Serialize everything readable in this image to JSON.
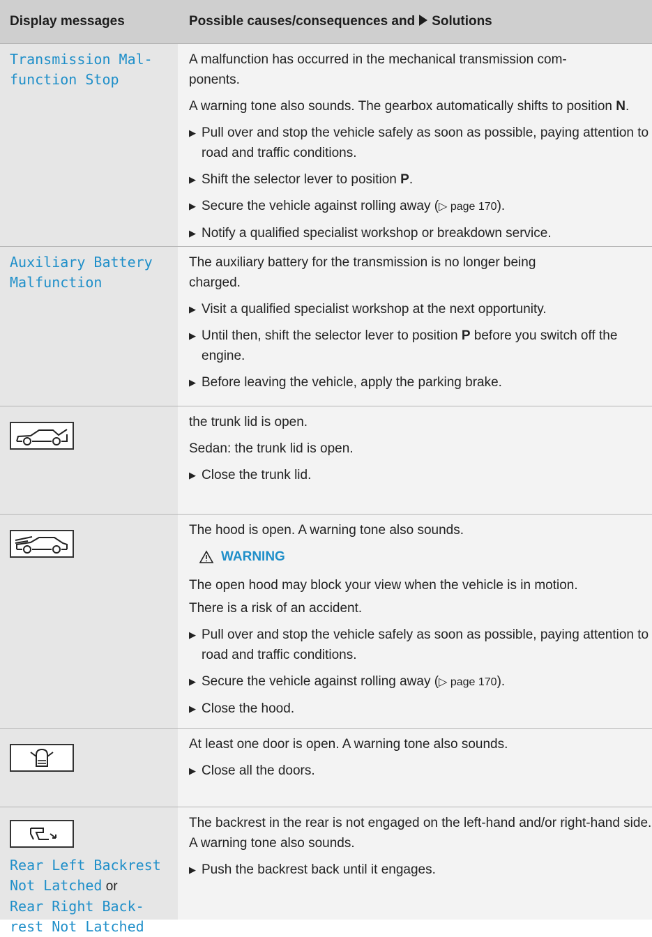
{
  "header": {
    "col1": "Display messages",
    "col2_a": "Possible causes/consequences and",
    "col2_b": "Solutions"
  },
  "rows": {
    "r0": {
      "msg": "Transmission Mal-\nfunction Stop",
      "p1": "A malfunction has occurred in the mechanical transmission com-\nponents.",
      "p2a": "A warning tone also sounds. The gearbox automatically shifts to position ",
      "p2b": "N",
      "p2c": ".",
      "b1": "Pull over and stop the vehicle safely as soon as possible, paying attention to road and traffic conditions.",
      "b2a": "Shift the selector lever to position ",
      "b2b": "P",
      "b2c": ".",
      "b3a": "Secure the vehicle against rolling away (",
      "b3ref": "▷ page 170",
      "b3c": ").",
      "b4": "Notify a qualified specialist workshop or breakdown service."
    },
    "r1": {
      "msg": "Auxiliary Battery\nMalfunction",
      "p1": "The auxiliary battery for the transmission is no longer being charged.",
      "b1": "Visit a qualified specialist workshop at the next opportunity.",
      "b2a": "Until then, shift the selector lever to position ",
      "b2b": "P",
      "b2c": " before you switch off the engine.",
      "b3": "Before leaving the vehicle, apply the parking brake."
    },
    "r2": {
      "icon": "trunk-open-icon",
      "p1": "the trunk lid is open.",
      "p2": "Sedan: the trunk lid is open.",
      "b1": "Close the trunk lid."
    },
    "r3": {
      "icon": "hood-open-icon",
      "p1": "The hood is open. A warning tone also sounds.",
      "warn": "WARNING",
      "p2": "The open hood may block your view when the vehicle is in motion.",
      "p3": "There is a risk of an accident.",
      "b1": "Pull over and stop the vehicle safely as soon as possible, paying attention to road and traffic conditions.",
      "b2a": "Secure the vehicle against rolling away (",
      "b2ref": "▷ page 170",
      "b2c": ").",
      "b3": "Close the hood."
    },
    "r4": {
      "icon": "door-open-icon",
      "p1": "At least one door is open. A warning tone also sounds.",
      "b1": "Close all the doors."
    },
    "r5": {
      "icon": "backrest-icon",
      "msg1": "Rear Left Backrest\nNot Latched",
      "or": " or",
      "msg2": "Rear Right Back-\nrest Not Latched",
      "p1": "The backrest in the rear is not engaged on the left-hand and/or right-hand side. A warning tone also sounds.",
      "b1": "Push the backrest back until it engages."
    }
  },
  "colors": {
    "accent": "#1f8fc9",
    "header_bg": "#cfcfcf",
    "left_bg": "#e6e6e6",
    "right_bg": "#f3f3f3"
  }
}
